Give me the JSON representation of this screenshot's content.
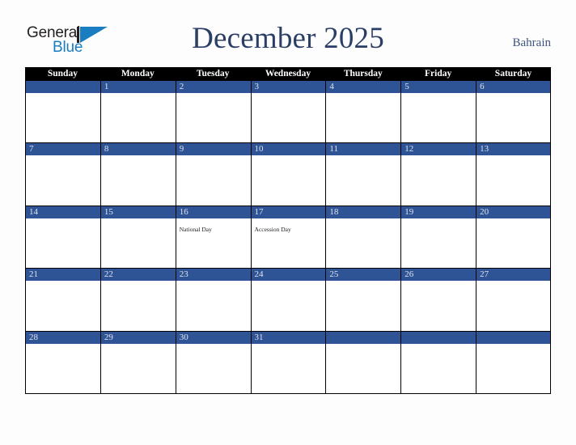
{
  "brand": {
    "line1": "General",
    "line2": "Blue",
    "mark": "triangle-logo-mark"
  },
  "header": {
    "title": "December 2025",
    "region": "Bahrain"
  },
  "colors": {
    "day_band": "#2e5496",
    "weekday_header_bg": "#000000",
    "title_text": "#2b3f66",
    "region_text": "#3f5480",
    "brand_blue": "#1a7cc1",
    "page_bg": "#fdfdfd",
    "cell_bg": "#ffffff",
    "day_number_text": "#dfe4ee"
  },
  "calendar": {
    "weekdays": [
      "Sunday",
      "Monday",
      "Tuesday",
      "Wednesday",
      "Thursday",
      "Friday",
      "Saturday"
    ],
    "weeks": [
      [
        {
          "day": "",
          "event": ""
        },
        {
          "day": "1",
          "event": ""
        },
        {
          "day": "2",
          "event": ""
        },
        {
          "day": "3",
          "event": ""
        },
        {
          "day": "4",
          "event": ""
        },
        {
          "day": "5",
          "event": ""
        },
        {
          "day": "6",
          "event": ""
        }
      ],
      [
        {
          "day": "7",
          "event": ""
        },
        {
          "day": "8",
          "event": ""
        },
        {
          "day": "9",
          "event": ""
        },
        {
          "day": "10",
          "event": ""
        },
        {
          "day": "11",
          "event": ""
        },
        {
          "day": "12",
          "event": ""
        },
        {
          "day": "13",
          "event": ""
        }
      ],
      [
        {
          "day": "14",
          "event": ""
        },
        {
          "day": "15",
          "event": ""
        },
        {
          "day": "16",
          "event": "National Day"
        },
        {
          "day": "17",
          "event": "Accession Day"
        },
        {
          "day": "18",
          "event": ""
        },
        {
          "day": "19",
          "event": ""
        },
        {
          "day": "20",
          "event": ""
        }
      ],
      [
        {
          "day": "21",
          "event": ""
        },
        {
          "day": "22",
          "event": ""
        },
        {
          "day": "23",
          "event": ""
        },
        {
          "day": "24",
          "event": ""
        },
        {
          "day": "25",
          "event": ""
        },
        {
          "day": "26",
          "event": ""
        },
        {
          "day": "27",
          "event": ""
        }
      ],
      [
        {
          "day": "28",
          "event": ""
        },
        {
          "day": "29",
          "event": ""
        },
        {
          "day": "30",
          "event": ""
        },
        {
          "day": "31",
          "event": ""
        },
        {
          "day": "",
          "event": ""
        },
        {
          "day": "",
          "event": ""
        },
        {
          "day": "",
          "event": ""
        }
      ]
    ]
  }
}
